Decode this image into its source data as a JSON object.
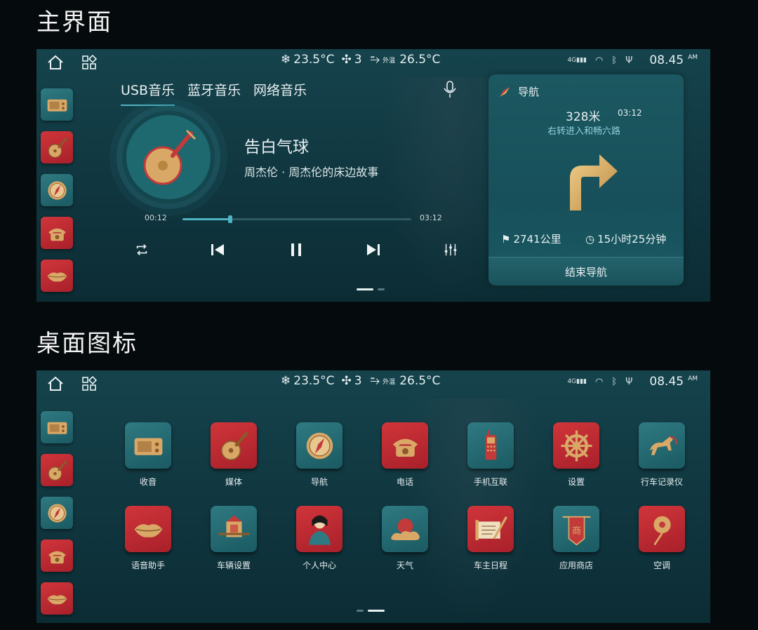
{
  "sections": {
    "main_title": "主界面",
    "desktop_title": "桌面图标"
  },
  "status": {
    "cabin_temp": "23.5°C",
    "fan_level": "3",
    "outside_label": "外温",
    "outside_temp": "26.5°C",
    "signal": "4G",
    "time": "08.45",
    "ampm": "AM"
  },
  "dock": [
    {
      "icon": "radio-icon",
      "color": "teal"
    },
    {
      "icon": "pipa-icon",
      "color": "red"
    },
    {
      "icon": "compass-icon",
      "color": "teal"
    },
    {
      "icon": "telephone-icon",
      "color": "red"
    },
    {
      "icon": "lips-icon",
      "color": "red"
    }
  ],
  "music": {
    "tabs": [
      "USB音乐",
      "蓝牙音乐",
      "网络音乐"
    ],
    "active_tab": 0,
    "song_title": "告白气球",
    "artist_album": "周杰伦 · 周杰伦的床边故事",
    "elapsed": "00:12",
    "duration": "03:12",
    "progress": 0.21
  },
  "navigation": {
    "title": "导航",
    "distance": "328米",
    "eta": "03:12",
    "instruction": "右转进入和畅六路",
    "maneuver": "turn-right",
    "total_distance": "2741公里",
    "total_time": "15小时25分钟",
    "end_button": "结束导航"
  },
  "apps": [
    {
      "label": "收音",
      "icon": "radio-icon",
      "color": "teal"
    },
    {
      "label": "媒体",
      "icon": "pipa-icon",
      "color": "red"
    },
    {
      "label": "导航",
      "icon": "compass-icon",
      "color": "teal"
    },
    {
      "label": "电话",
      "icon": "telephone-icon",
      "color": "red"
    },
    {
      "label": "手机互联",
      "icon": "mobile-phone-icon",
      "color": "teal"
    },
    {
      "label": "设置",
      "icon": "helm-wheel-icon",
      "color": "red"
    },
    {
      "label": "行车记录仪",
      "icon": "horse-icon",
      "color": "teal"
    },
    {
      "label": "语音助手",
      "icon": "lips-icon",
      "color": "red"
    },
    {
      "label": "车辆设置",
      "icon": "sedan-chair-icon",
      "color": "teal"
    },
    {
      "label": "个人中心",
      "icon": "lady-portrait-icon",
      "color": "red"
    },
    {
      "label": "天气",
      "icon": "sun-cloud-icon",
      "color": "teal"
    },
    {
      "label": "车主日程",
      "icon": "scroll-brush-icon",
      "color": "red"
    },
    {
      "label": "应用商店",
      "icon": "shop-banner-icon",
      "color": "teal"
    },
    {
      "label": "空调",
      "icon": "fan-icon",
      "color": "red"
    }
  ],
  "shop_banner_text": "商",
  "colors": {
    "teal_tile": "#237079",
    "red_tile": "#c22b32",
    "gold": "#d9a867",
    "accent": "#4fb3c4"
  }
}
